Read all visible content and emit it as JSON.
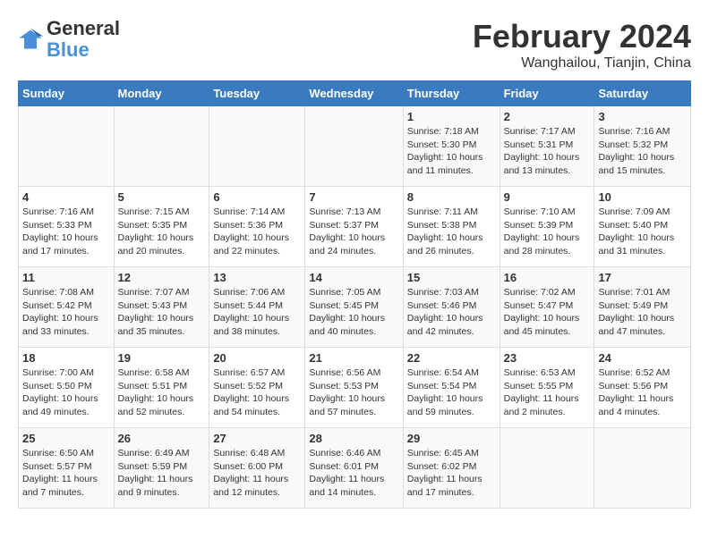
{
  "header": {
    "logo": {
      "line1": "General",
      "line2": "Blue"
    },
    "title": "February 2024",
    "location": "Wanghailou, Tianjin, China"
  },
  "days_of_week": [
    "Sunday",
    "Monday",
    "Tuesday",
    "Wednesday",
    "Thursday",
    "Friday",
    "Saturday"
  ],
  "weeks": [
    [
      {
        "day": "",
        "info": ""
      },
      {
        "day": "",
        "info": ""
      },
      {
        "day": "",
        "info": ""
      },
      {
        "day": "",
        "info": ""
      },
      {
        "day": "1",
        "info": "Sunrise: 7:18 AM\nSunset: 5:30 PM\nDaylight: 10 hours\nand 11 minutes."
      },
      {
        "day": "2",
        "info": "Sunrise: 7:17 AM\nSunset: 5:31 PM\nDaylight: 10 hours\nand 13 minutes."
      },
      {
        "day": "3",
        "info": "Sunrise: 7:16 AM\nSunset: 5:32 PM\nDaylight: 10 hours\nand 15 minutes."
      }
    ],
    [
      {
        "day": "4",
        "info": "Sunrise: 7:16 AM\nSunset: 5:33 PM\nDaylight: 10 hours\nand 17 minutes."
      },
      {
        "day": "5",
        "info": "Sunrise: 7:15 AM\nSunset: 5:35 PM\nDaylight: 10 hours\nand 20 minutes."
      },
      {
        "day": "6",
        "info": "Sunrise: 7:14 AM\nSunset: 5:36 PM\nDaylight: 10 hours\nand 22 minutes."
      },
      {
        "day": "7",
        "info": "Sunrise: 7:13 AM\nSunset: 5:37 PM\nDaylight: 10 hours\nand 24 minutes."
      },
      {
        "day": "8",
        "info": "Sunrise: 7:11 AM\nSunset: 5:38 PM\nDaylight: 10 hours\nand 26 minutes."
      },
      {
        "day": "9",
        "info": "Sunrise: 7:10 AM\nSunset: 5:39 PM\nDaylight: 10 hours\nand 28 minutes."
      },
      {
        "day": "10",
        "info": "Sunrise: 7:09 AM\nSunset: 5:40 PM\nDaylight: 10 hours\nand 31 minutes."
      }
    ],
    [
      {
        "day": "11",
        "info": "Sunrise: 7:08 AM\nSunset: 5:42 PM\nDaylight: 10 hours\nand 33 minutes."
      },
      {
        "day": "12",
        "info": "Sunrise: 7:07 AM\nSunset: 5:43 PM\nDaylight: 10 hours\nand 35 minutes."
      },
      {
        "day": "13",
        "info": "Sunrise: 7:06 AM\nSunset: 5:44 PM\nDaylight: 10 hours\nand 38 minutes."
      },
      {
        "day": "14",
        "info": "Sunrise: 7:05 AM\nSunset: 5:45 PM\nDaylight: 10 hours\nand 40 minutes."
      },
      {
        "day": "15",
        "info": "Sunrise: 7:03 AM\nSunset: 5:46 PM\nDaylight: 10 hours\nand 42 minutes."
      },
      {
        "day": "16",
        "info": "Sunrise: 7:02 AM\nSunset: 5:47 PM\nDaylight: 10 hours\nand 45 minutes."
      },
      {
        "day": "17",
        "info": "Sunrise: 7:01 AM\nSunset: 5:49 PM\nDaylight: 10 hours\nand 47 minutes."
      }
    ],
    [
      {
        "day": "18",
        "info": "Sunrise: 7:00 AM\nSunset: 5:50 PM\nDaylight: 10 hours\nand 49 minutes."
      },
      {
        "day": "19",
        "info": "Sunrise: 6:58 AM\nSunset: 5:51 PM\nDaylight: 10 hours\nand 52 minutes."
      },
      {
        "day": "20",
        "info": "Sunrise: 6:57 AM\nSunset: 5:52 PM\nDaylight: 10 hours\nand 54 minutes."
      },
      {
        "day": "21",
        "info": "Sunrise: 6:56 AM\nSunset: 5:53 PM\nDaylight: 10 hours\nand 57 minutes."
      },
      {
        "day": "22",
        "info": "Sunrise: 6:54 AM\nSunset: 5:54 PM\nDaylight: 10 hours\nand 59 minutes."
      },
      {
        "day": "23",
        "info": "Sunrise: 6:53 AM\nSunset: 5:55 PM\nDaylight: 11 hours\nand 2 minutes."
      },
      {
        "day": "24",
        "info": "Sunrise: 6:52 AM\nSunset: 5:56 PM\nDaylight: 11 hours\nand 4 minutes."
      }
    ],
    [
      {
        "day": "25",
        "info": "Sunrise: 6:50 AM\nSunset: 5:57 PM\nDaylight: 11 hours\nand 7 minutes."
      },
      {
        "day": "26",
        "info": "Sunrise: 6:49 AM\nSunset: 5:59 PM\nDaylight: 11 hours\nand 9 minutes."
      },
      {
        "day": "27",
        "info": "Sunrise: 6:48 AM\nSunset: 6:00 PM\nDaylight: 11 hours\nand 12 minutes."
      },
      {
        "day": "28",
        "info": "Sunrise: 6:46 AM\nSunset: 6:01 PM\nDaylight: 11 hours\nand 14 minutes."
      },
      {
        "day": "29",
        "info": "Sunrise: 6:45 AM\nSunset: 6:02 PM\nDaylight: 11 hours\nand 17 minutes."
      },
      {
        "day": "",
        "info": ""
      },
      {
        "day": "",
        "info": ""
      }
    ]
  ]
}
